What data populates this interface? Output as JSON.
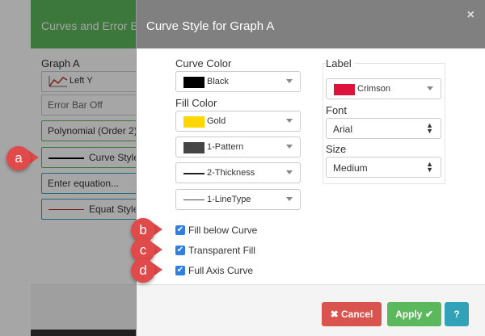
{
  "background_panel": {
    "header_title": "Curves and Error Ba",
    "graph_label": "Graph A",
    "fields": [
      {
        "text": "Left Y"
      },
      {
        "text": "Error Bar Off"
      },
      {
        "text": "Polynomial (Order 2)"
      },
      {
        "text": "Curve Style"
      },
      {
        "text": "Enter equation..."
      },
      {
        "text": "Equat Style"
      }
    ]
  },
  "dialog": {
    "title": "Curve Style for Graph A",
    "close_symbol": "×",
    "curve_color_label": "Curve Color",
    "curve_color": {
      "text": "Black",
      "color": "#000000"
    },
    "fill_color_label": "Fill Color",
    "fill_color": {
      "text": "Gold",
      "color": "#ffd700"
    },
    "pattern": {
      "text": "1-Pattern",
      "color": "#444444"
    },
    "thickness": {
      "text": "2-Thickness"
    },
    "linetype": {
      "text": "1-LineType"
    },
    "label_section": "Label",
    "label_color": {
      "text": "Crimson",
      "color": "#dc143c"
    },
    "font_label": "Font",
    "font_value": "Arial",
    "size_label": "Size",
    "size_value": "Medium",
    "checkboxes": [
      {
        "label": "Fill below Curve",
        "checked": true
      },
      {
        "label": "Transparent Fill",
        "checked": true
      },
      {
        "label": "Full Axis Curve",
        "checked": true
      }
    ],
    "buttons": {
      "cancel": "Cancel",
      "apply": "Apply",
      "help": "?"
    }
  },
  "callouts": [
    "a",
    "b",
    "c",
    "d"
  ],
  "colors": {
    "header_gray": "#808080",
    "green": "#5cb85c",
    "red": "#d9534f",
    "blue": "#31a2b8",
    "badge": "#e04a4a"
  },
  "icons": {
    "chart_line": "chart-line-icon",
    "close": "close-icon",
    "cancel": "times-icon",
    "apply": "check-icon",
    "help": "question-icon",
    "caret": "caret-down-icon",
    "updown": "sort-icon"
  }
}
